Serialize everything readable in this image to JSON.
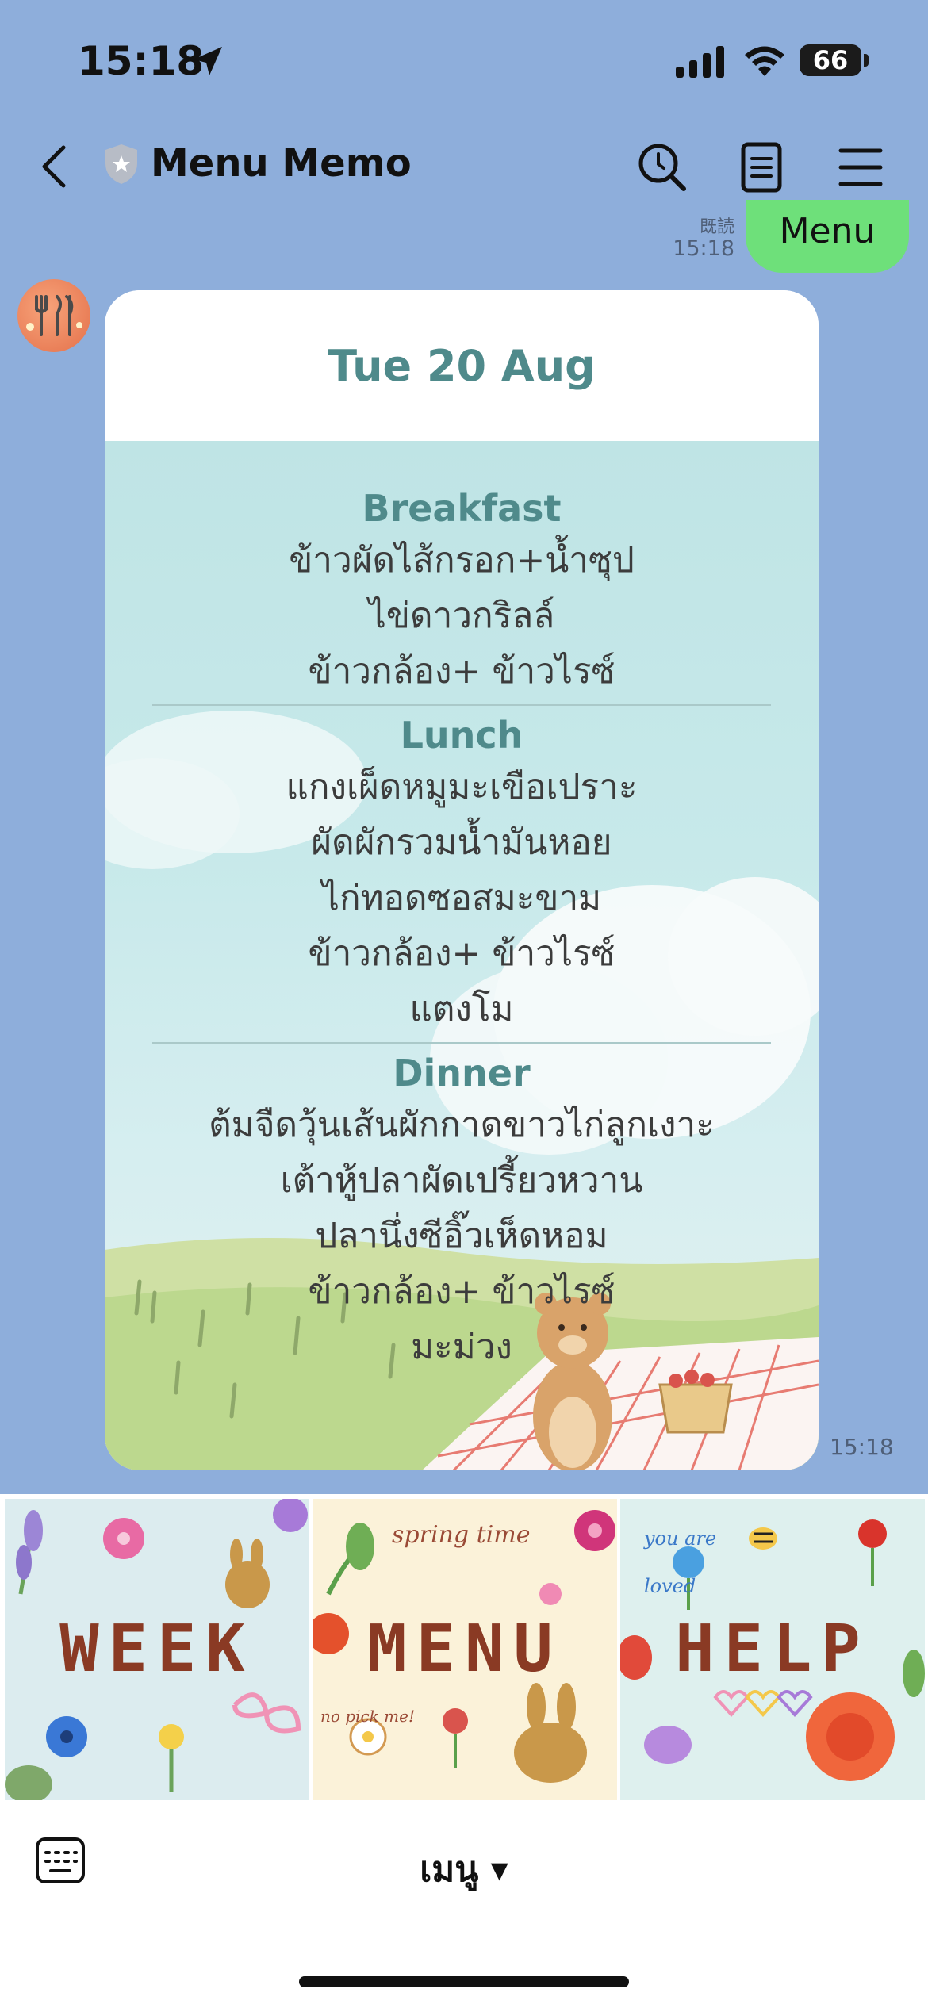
{
  "status_bar": {
    "time": "15:18",
    "battery": "66"
  },
  "header": {
    "title": "Menu Memo"
  },
  "sent_message": {
    "read_label": "既読",
    "time": "15:18",
    "text": "Menu"
  },
  "card": {
    "date": "Tue 20 Aug",
    "meals": [
      {
        "title": "Breakfast",
        "items": [
          "ข้าวผัดไส้กรอก+น้ำซุป",
          "ไข่ดาวกริลล์",
          "ข้าวกล้อง+ ข้าวไรซ์"
        ]
      },
      {
        "title": "Lunch",
        "items": [
          "แกงเผ็ดหมูมะเขือเปราะ",
          "ผัดผักรวมน้ำมันหอย",
          "ไก่ทอดซอสมะขาม",
          "ข้าวกล้อง+ ข้าวไรซ์",
          "แตงโม"
        ]
      },
      {
        "title": "Dinner",
        "items": [
          "ต้มจืดวุ้นเส้นผักกาดขาวไก่ลูกเงาะ",
          "เต้าหู้ปลาผัดเปรี้ยวหวาน",
          "ปลานึ่งซีอิ๊วเห็ดหอม",
          "ข้าวกล้อง+ ข้าวไรซ์",
          "มะม่วง"
        ]
      }
    ],
    "time": "15:18"
  },
  "rich_menu": {
    "tiles": [
      {
        "label": "WEEK"
      },
      {
        "label": "MENU",
        "caption_top": "spring time",
        "caption_bottom": "no pick me!"
      },
      {
        "label": "HELP",
        "caption_top": "you are loved"
      }
    ]
  },
  "bottom_bar": {
    "menu_toggle": "เมนู ▾"
  },
  "colors": {
    "chat_background": "#8eaedb",
    "sent_bubble": "#6ee07a",
    "card_title": "#4f8a8b",
    "rich_menu_text": "#8a3a24"
  }
}
